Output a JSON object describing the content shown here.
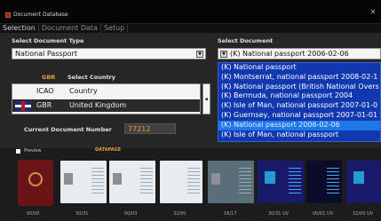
{
  "window": {
    "title": "Document Database"
  },
  "tabs": [
    "Selection",
    "Document Data",
    "Setup"
  ],
  "left": {
    "document_type_label": "Select Document Type",
    "document_type_value": "National Passport",
    "country_code_badge": "GBR",
    "select_country_label": "Select Country",
    "grid_header": {
      "code": "ICAO",
      "name": "Country"
    },
    "grid_row": {
      "code": "GBR",
      "name": "United Kingdom"
    },
    "doc_number_label": "Current Document Number",
    "doc_number_value": "77212"
  },
  "right": {
    "select_document_label": "Select Document",
    "select_document_value": "(K) National passport 2006-02-06",
    "documents": [
      "(K) National passport",
      "(K) Montserrat, national passport 2008-02-1",
      "(K) National passport (British National Overs",
      "(K) Bermuda, national passport 2004",
      "(K) Isle of Man, national passport 2007-01-0",
      "(K) Guernsey, national passport 2007-01-01",
      "(K) National passport 2006-02-06",
      "(K) Isle of Man, national passport"
    ],
    "selected_index": 6
  },
  "bottom": {
    "preview_label": "Preview",
    "datapage_label": "DATAPAGE",
    "captions": [
      "00/00",
      "30/31",
      "00/03",
      "32/00",
      "16/17",
      "30/31 UV",
      "00/01 UV",
      "32/00 UV"
    ]
  },
  "colors": {
    "accent": "#e8a040",
    "list_bg": "#1238b0",
    "list_selected": "#1e78e8"
  }
}
